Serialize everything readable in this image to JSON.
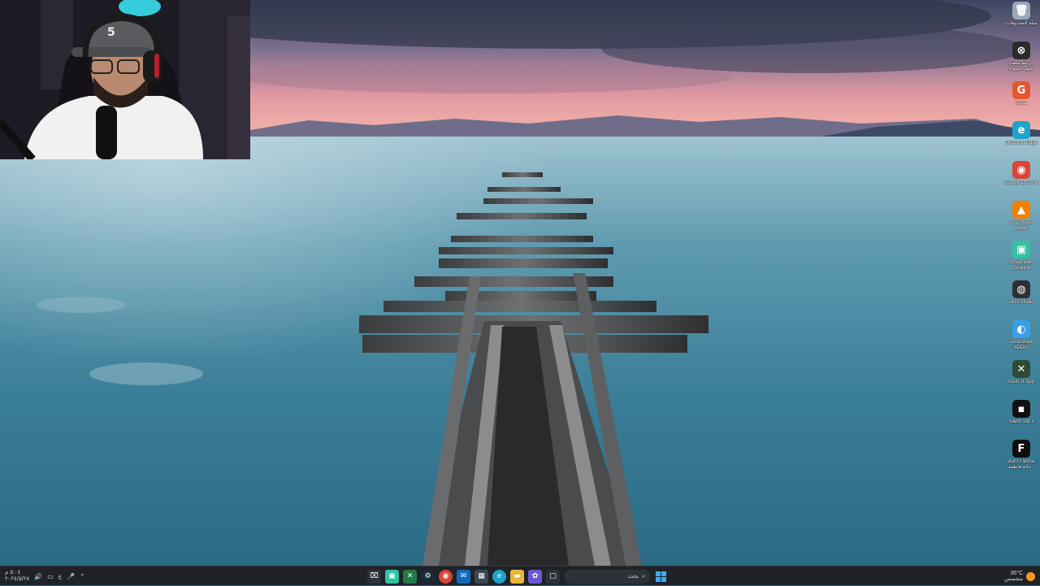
{
  "desktop_icons": [
    {
      "name": "recycle-bin",
      "label": "سلة المحذوفات",
      "glyph": "🗑",
      "color": "#9aa9b8"
    },
    {
      "name": "gdrive",
      "label": "خرائط ملعب ملقر المنوع",
      "glyph": "⊗",
      "color": "#2b2b2b"
    },
    {
      "name": "gcc",
      "label": "GCC",
      "glyph": "G",
      "color": "#e4572e"
    },
    {
      "name": "edge",
      "label": "Microsoft Edge",
      "glyph": "e",
      "color": "#1fa4c9"
    },
    {
      "name": "chrome",
      "label": "Google Chrome",
      "glyph": "◉",
      "color": "#db4437"
    },
    {
      "name": "vlc",
      "label": "VLC media player",
      "glyph": "▲",
      "color": "#f08000"
    },
    {
      "name": "streamlabs",
      "label": "Streamlabs Desktop",
      "glyph": "▣",
      "color": "#31c3a2"
    },
    {
      "name": "obs",
      "label": "OBS Studio",
      "glyph": "◍",
      "color": "#302e31"
    },
    {
      "name": "tenorshare",
      "label": "Tenorshare 4DDiG",
      "glyph": "◐",
      "color": "#3aa0e6"
    },
    {
      "name": "goxlr",
      "label": "GoXLR App",
      "glyph": "✕",
      "color": "#2f4a35"
    },
    {
      "name": "silent-still",
      "label": "Silent Still 2",
      "glyph": "▪",
      "color": "#111111"
    },
    {
      "name": "aunt-fatima",
      "label": "Aunt Fatima خالة فاطمة -",
      "glyph": "F",
      "color": "#0d0d0d"
    }
  ],
  "taskbar": {
    "clock_time": "٥:٠٤ م",
    "clock_date": "٢٠٢٤/٥/٢٨",
    "lang": "ع",
    "search_placeholder": "بحث",
    "weather_temp": "36°C",
    "weather_text": "مشمس"
  }
}
